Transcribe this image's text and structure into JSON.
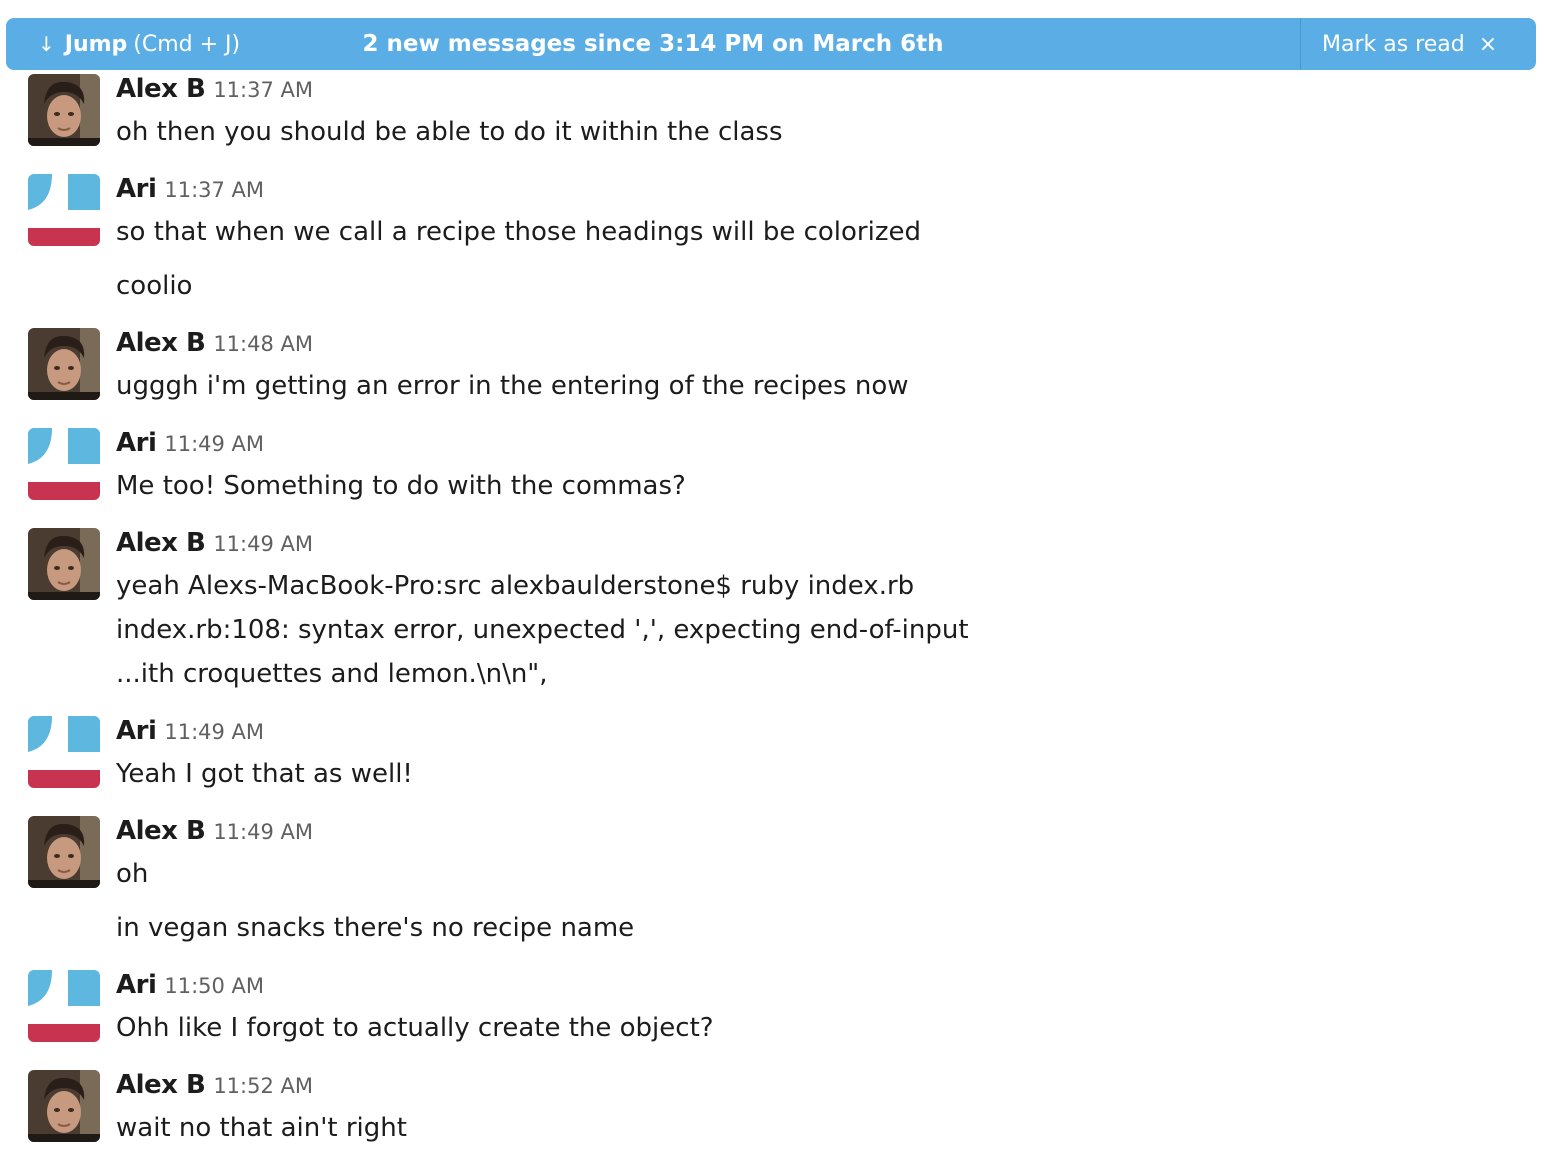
{
  "banner": {
    "jump_arrow": "↓",
    "jump_label": "Jump",
    "jump_hint": "(Cmd + J)",
    "message": "2 new messages since 3:14 PM on March 6th",
    "mark_read_label": "Mark as read",
    "close_glyph": "×"
  },
  "colors": {
    "banner_bg": "#5aaee5",
    "ari_avatar_blue": "#5db7de",
    "ari_avatar_red": "#c8334f"
  },
  "messages": [
    {
      "author": "Alex B",
      "time": "11:37 AM",
      "avatar": "photo-avatar",
      "lines": [
        "oh then you should be able to do it within the class"
      ]
    },
    {
      "author": "Ari",
      "time": "11:37 AM",
      "avatar": "ari-identicon",
      "lines": [
        "so that when we call a recipe those headings will be colorized",
        "coolio"
      ]
    },
    {
      "author": "Alex B",
      "time": "11:48 AM",
      "avatar": "photo-avatar",
      "lines": [
        "ugggh i'm getting an error in the entering of the recipes now"
      ]
    },
    {
      "author": "Ari",
      "time": "11:49 AM",
      "avatar": "ari-identicon",
      "lines": [
        "Me too! Something to do with the commas?"
      ]
    },
    {
      "author": "Alex B",
      "time": "11:49 AM",
      "avatar": "photo-avatar",
      "lines": [
        "yeah Alexs-MacBook-Pro:src alexbaulderstone$ ruby index.rb",
        "index.rb:108: syntax error, unexpected ',', expecting end-of-input",
        "...ith croquettes and lemon.\\n\\n\","
      ]
    },
    {
      "author": "Ari",
      "time": "11:49 AM",
      "avatar": "ari-identicon",
      "lines": [
        "Yeah I got that as well!"
      ]
    },
    {
      "author": "Alex B",
      "time": "11:49 AM",
      "avatar": "photo-avatar",
      "lines": [
        "oh",
        "in vegan snacks there's no recipe name"
      ]
    },
    {
      "author": "Ari",
      "time": "11:50 AM",
      "avatar": "ari-identicon",
      "lines": [
        "Ohh like I forgot to actually create the object?"
      ]
    },
    {
      "author": "Alex B",
      "time": "11:52 AM",
      "avatar": "photo-avatar",
      "lines": [
        "wait no that ain't right"
      ]
    }
  ]
}
